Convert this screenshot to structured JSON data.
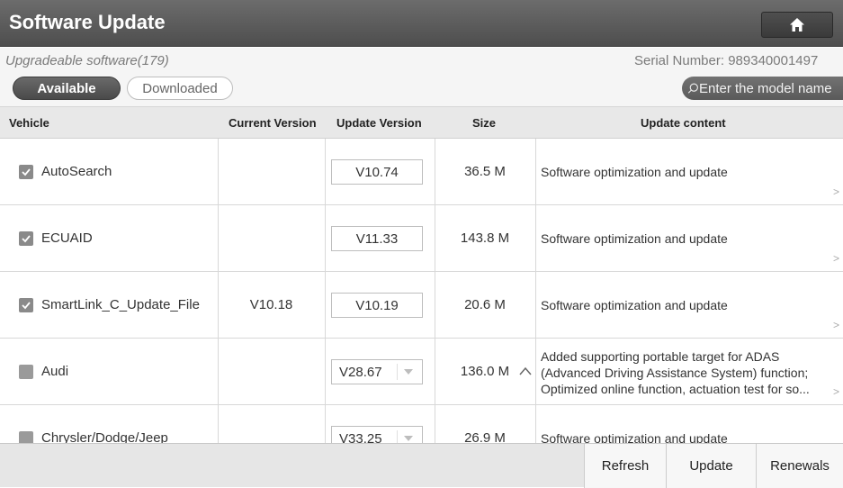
{
  "header": {
    "title": "Software Update",
    "home_icon": "home-icon"
  },
  "subbar": {
    "upgradeable": "Upgradeable software(179)",
    "serial": "Serial Number: 989340001497",
    "tabs": [
      "Available",
      "Downloaded"
    ],
    "active_tab": "Available",
    "search_placeholder": "Enter the model name"
  },
  "table": {
    "columns": [
      "Vehicle",
      "Current Version",
      "Update Version",
      "Size",
      "Update content"
    ],
    "rows": [
      {
        "checked": true,
        "vehicle": "AutoSearch",
        "current": "",
        "update": "V10.74",
        "dropdown": false,
        "size": "36.5 M",
        "content": [
          "Software optimization and update"
        ],
        "expanded": false
      },
      {
        "checked": true,
        "vehicle": "ECUAID",
        "current": "",
        "update": "V11.33",
        "dropdown": false,
        "size": "143.8 M",
        "content": [
          "Software optimization and update"
        ],
        "expanded": false
      },
      {
        "checked": true,
        "vehicle": "SmartLink_C_Update_File",
        "current": "V10.18",
        "update": "V10.19",
        "dropdown": false,
        "size": "20.6 M",
        "content": [
          "Software optimization and update"
        ],
        "expanded": false
      },
      {
        "checked": false,
        "vehicle": "Audi",
        "current": "",
        "update": "V28.67",
        "dropdown": true,
        "size": "136.0 M",
        "content": [
          "Added supporting portable target for ADAS",
          "(Advanced Driving Assistance System) function;",
          "Optimized online function, actuation test for so..."
        ],
        "expanded": true
      },
      {
        "checked": false,
        "vehicle": "Chrysler/Dodge/Jeep",
        "current": "",
        "update": "V33.25",
        "dropdown": true,
        "size": "26.9 M",
        "content": [
          "Software optimization and update"
        ],
        "expanded": false
      }
    ]
  },
  "footer": {
    "refresh": "Refresh",
    "update": "Update",
    "renewals": "Renewals"
  }
}
